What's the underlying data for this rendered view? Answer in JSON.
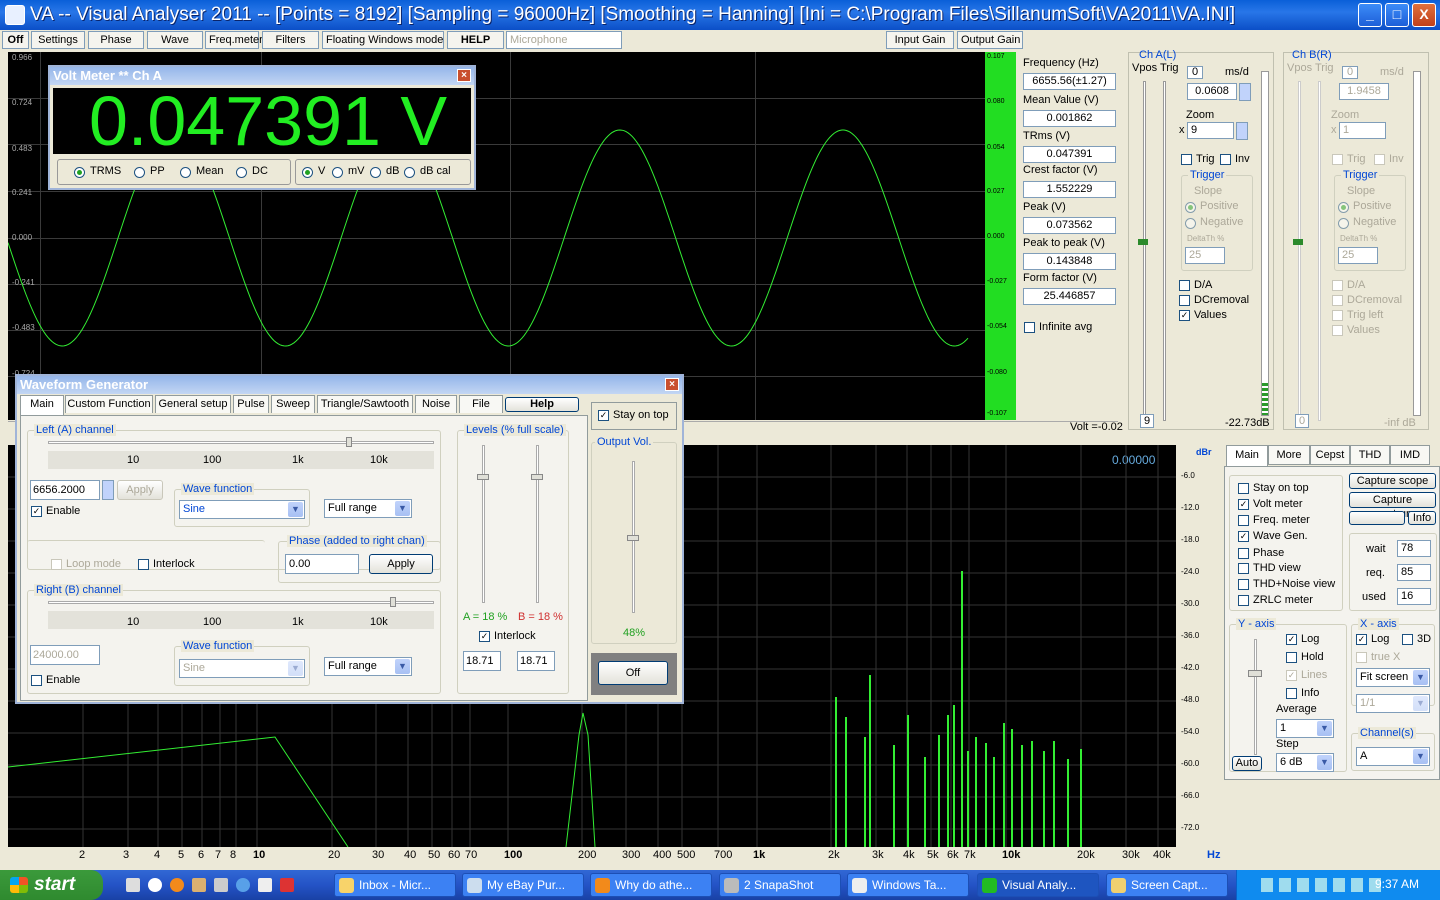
{
  "window": {
    "title": "VA -- Visual Analyser 2011 --  [Points = 8192]  [Sampling = 96000Hz]  [Smoothing = Hanning]  [Ini = C:\\Program Files\\SillanumSoft\\VA2011\\VA.INI]",
    "minimize": "_",
    "maximize": "□",
    "close": "X"
  },
  "toolbar": {
    "off": "Off",
    "settings": "Settings",
    "phase": "Phase",
    "wave": "Wave",
    "freqmeter": "Freq.meter",
    "filters": "Filters",
    "floating": "Floating Windows mode",
    "help": "HELP",
    "microphone": "Microphone",
    "input_gain": "Input Gain",
    "output_gain": "Output Gain"
  },
  "scope": {
    "y_left": [
      "0.966",
      "0.724",
      "0.483",
      "0.241",
      "0.000",
      "-0.241",
      "-0.483",
      "-0.724"
    ],
    "y_right": [
      "0.107",
      "0.080",
      "0.054",
      "0.027",
      "0.000",
      "-0.027",
      "-0.054",
      "-0.080",
      "-0.107"
    ],
    "volt_readout": "Volt =-0.02",
    "trace_color": "#33ee33"
  },
  "measurements": {
    "frequency_label": "Frequency (Hz)",
    "frequency": "6655.56(±1.27)",
    "mean_label": "Mean Value (V)",
    "mean": "0.001862",
    "trms_label": "TRms (V)",
    "trms": "0.047391",
    "crest_label": "Crest factor (V)",
    "crest": "1.552229",
    "peak_label": "Peak (V)",
    "peak": "0.073562",
    "p2p_label": "Peak to peak (V)",
    "p2p": "0.143848",
    "form_label": "Form factor (V)",
    "form": "25.446857",
    "infinite_avg": "Infinite avg"
  },
  "chA": {
    "title": "Ch A(L)",
    "vpos": "Vpos",
    "trig": "Trig",
    "zero": "0",
    "msd": "ms/d",
    "ms_value": "0.0608",
    "zoom_label": "Zoom",
    "times": "x",
    "zoom": "9",
    "trig_chk": "Trig",
    "inv": "Inv",
    "trigger_label": "Trigger",
    "slope": "Slope",
    "positive": "Positive",
    "negative": "Negative",
    "deltath": "DeltaTh %",
    "deltath_val": "25",
    "da": "D/A",
    "dcremoval": "DCremoval",
    "values": "Values",
    "bottom_zero": "9",
    "db": "-22.73dB"
  },
  "chB": {
    "title": "Ch B(R)",
    "vpos": "Vpos",
    "trig": "Trig",
    "zero": "0",
    "msd": "ms/d",
    "ms_value": "1.9458",
    "zoom_label": "Zoom",
    "times": "x",
    "zoom": "1",
    "trig_chk": "Trig",
    "inv": "Inv",
    "trigger_label": "Trigger",
    "slope": "Slope",
    "positive": "Positive",
    "negative": "Negative",
    "deltath": "DeltaTh %",
    "deltath_val": "25",
    "da": "D/A",
    "dcremoval": "DCremoval",
    "trigleft": "Trig left",
    "values": "Values",
    "bottom_zero": "0",
    "db": "-inf dB"
  },
  "voltmeter": {
    "title": "Volt Meter ** Ch A",
    "reading": "0.047391 V",
    "modes": [
      "TRMS",
      "PP",
      "Mean",
      "DC"
    ],
    "units": [
      "V",
      "mV",
      "dB",
      "dB cal"
    ]
  },
  "spectrum": {
    "readout": "0.00000",
    "y_labels": [
      "dBr",
      "-6.0",
      "-12.0",
      "-18.0",
      "-24.0",
      "-30.0",
      "-36.0",
      "-42.0",
      "-48.0",
      "-54.0",
      "-60.0",
      "-66.0",
      "-72.0"
    ],
    "x_labels": [
      "2",
      "3",
      "4",
      "5",
      "6",
      "7",
      "8",
      "10",
      "20",
      "30",
      "40",
      "50",
      "60",
      "70",
      "100",
      "200",
      "300",
      "400",
      "500",
      "700",
      "1k",
      "2k",
      "3k",
      "4k",
      "5k",
      "6k",
      "7k",
      "10k",
      "20k",
      "30k",
      "40k",
      "Hz"
    ]
  },
  "wavegen": {
    "title": "Waveform Generator",
    "tabs": [
      "Main",
      "Custom Function",
      "General setup",
      "Pulse",
      "Sweep",
      "Triangle/Sawtooth",
      "Noise",
      "File"
    ],
    "help": "Help",
    "left_label": "Left (A) channel",
    "scale": [
      "10",
      "100",
      "1k",
      "10k"
    ],
    "left_freq": "6656.2000",
    "apply": "Apply",
    "enable": "Enable",
    "wave_function": "Wave function",
    "left_wave": "Sine",
    "range": "Full range",
    "loop_mode": "Loop mode",
    "interlock": "Interlock",
    "phase_label": "Phase (added to right chan)",
    "phase": "0.00",
    "phase_apply": "Apply",
    "right_label": "Right (B) channel",
    "right_freq": "24000.00",
    "right_wave": "Sine",
    "right_range": "Full range",
    "right_enable": "Enable",
    "levels_label": "Levels (% full scale)",
    "level_a": "A = 18 %",
    "level_b": "B = 18 %",
    "levels_interlock": "Interlock",
    "level_a_val": "18.71",
    "level_b_val": "18.71",
    "stay_on_top": "Stay on top",
    "output_vol": "Output Vol.",
    "output_pct": "48%",
    "off": "Off"
  },
  "rightpanel": {
    "tabs": [
      "Main",
      "More",
      "Cepst",
      "THD",
      "IMD"
    ],
    "checks": [
      "Stay on top",
      "Volt meter",
      "Freq. meter",
      "Wave Gen.",
      "Phase",
      "THD view",
      "THD+Noise view",
      "ZRLC meter"
    ],
    "capture_scope": "Capture scope",
    "capture_spectrum": "Capture spectrum",
    "info": "Info",
    "wait_label": "wait",
    "wait": "78",
    "req_label": "req.",
    "req": "85",
    "used_label": "used",
    "used": "16",
    "yaxis": "Y - axis",
    "log": "Log",
    "hold": "Hold",
    "lines": "Lines",
    "yinfo": "Info",
    "average": "Average",
    "average_val": "1",
    "step": "Step",
    "step_val": "6 dB",
    "auto": "Auto",
    "xaxis": "X - axis",
    "xlog": "Log",
    "x3d": "3D",
    "truex": "true X",
    "fit": "Fit screen",
    "ratio": "1/1",
    "channels": "Channel(s)",
    "channel_val": "A"
  },
  "taskbar": {
    "start": "start",
    "items": [
      "Inbox - Micr...",
      "My eBay Pur...",
      "Why do athe...",
      "2 SnapaShot",
      "Windows Ta...",
      "Visual Analy...",
      "Screen Capt..."
    ],
    "clock": "9:37 AM"
  }
}
